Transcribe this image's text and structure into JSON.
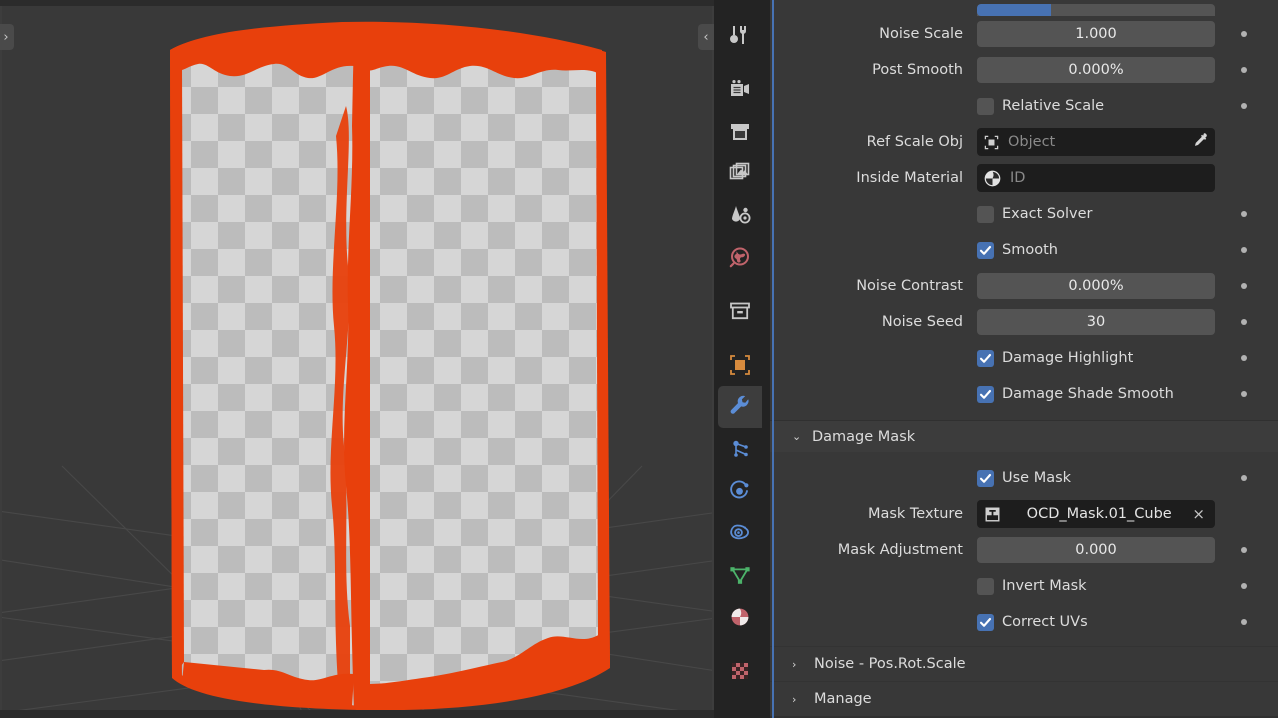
{
  "viewport": {
    "name": "3d-viewport",
    "bg_color": "#393939",
    "grid_color": "#4a4a4a",
    "left_arrow": "›",
    "right_arrow": "‹",
    "object": {
      "description": "damaged-cube-with-checker-texture",
      "surface_color": "#d4d4d4",
      "checker_alt_color": "#bcbcbc",
      "inside_material_color": "#e8400c"
    }
  },
  "tabs": {
    "items": [
      {
        "name": "tool",
        "icon": "tool-icon",
        "active": false
      },
      {
        "name": "render",
        "icon": "render-camera-icon",
        "active": false
      },
      {
        "name": "output",
        "icon": "output-printer-icon",
        "active": false
      },
      {
        "name": "view-layer",
        "icon": "view-layer-images-icon",
        "active": false
      },
      {
        "name": "scene",
        "icon": "scene-cone-icon",
        "active": false
      },
      {
        "name": "world",
        "icon": "world-globe-icon",
        "active": false
      },
      {
        "name": "collection",
        "icon": "collection-box-icon",
        "active": false
      },
      {
        "name": "object",
        "icon": "object-square-icon",
        "active": false
      },
      {
        "name": "modifiers",
        "icon": "wrench-icon",
        "active": true
      },
      {
        "name": "particles",
        "icon": "particles-icon",
        "active": false
      },
      {
        "name": "physics",
        "icon": "physics-orbit-icon",
        "active": false
      },
      {
        "name": "constraints",
        "icon": "constraints-icon",
        "active": false
      },
      {
        "name": "object-data",
        "icon": "mesh-data-triangle-icon",
        "active": false
      },
      {
        "name": "material",
        "icon": "material-sphere-icon",
        "active": false
      },
      {
        "name": "texture",
        "icon": "texture-checker-icon",
        "active": false
      }
    ],
    "active_color": "#3d3d3d"
  },
  "properties": {
    "accent_color": "#4772b3",
    "decorator_color": "#b2b2b2",
    "top_partial_slider": {
      "name": "partial-slider",
      "fill_percent": 31
    },
    "rows": [
      {
        "type": "number",
        "label": "Noise Scale",
        "value": "1.000",
        "decorator": true
      },
      {
        "type": "number",
        "label": "Post Smooth",
        "value": "0.000%",
        "decorator": true
      },
      {
        "type": "checkbox",
        "label": "Relative Scale",
        "checked": false,
        "decorator": true
      },
      {
        "type": "id",
        "label": "Ref Scale Obj",
        "value": "",
        "placeholder": "Object",
        "icon": "object-outline-icon",
        "eyedropper": true,
        "decorator": false
      },
      {
        "type": "id",
        "label": "Inside Material",
        "value": "",
        "placeholder": "ID",
        "icon": "material-sphere-icon",
        "eyedropper": false,
        "decorator": false
      },
      {
        "type": "checkbox",
        "label": "Exact Solver",
        "checked": false,
        "decorator": true
      },
      {
        "type": "checkbox",
        "label": "Smooth",
        "checked": true,
        "decorator": true
      },
      {
        "type": "number",
        "label": "Noise Contrast",
        "value": "0.000%",
        "decorator": true
      },
      {
        "type": "number",
        "label": "Noise Seed",
        "value": "30",
        "decorator": true
      },
      {
        "type": "checkbox",
        "label": "Damage Highlight",
        "checked": true,
        "decorator": true
      },
      {
        "type": "checkbox",
        "label": "Damage Shade Smooth",
        "checked": true,
        "decorator": true
      }
    ],
    "damage_mask_panel": {
      "title": "Damage Mask",
      "expanded": true,
      "triangle": "⌄",
      "rows": [
        {
          "type": "checkbox",
          "label": "Use Mask",
          "checked": true,
          "decorator": true
        },
        {
          "type": "id",
          "label": "Mask Texture",
          "value": "OCD_Mask.01_Cube",
          "placeholder": "",
          "icon": "image-texture-icon",
          "clear": "×",
          "decorator": false
        },
        {
          "type": "number",
          "label": "Mask Adjustment",
          "value": "0.000",
          "decorator": true
        },
        {
          "type": "checkbox",
          "label": "Invert Mask",
          "checked": false,
          "decorator": true
        },
        {
          "type": "checkbox",
          "label": "Correct UVs",
          "checked": true,
          "decorator": true
        }
      ]
    },
    "closed_panels": [
      {
        "title": "Noise - Pos.Rot.Scale",
        "triangle": "›"
      },
      {
        "title": "Manage",
        "triangle": "›"
      }
    ]
  }
}
